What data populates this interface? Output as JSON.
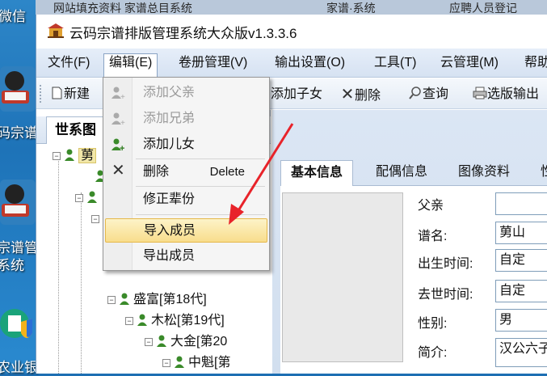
{
  "desktop": {
    "taskbar_items": [
      "网站填充资料 家谱总目系统",
      "家谱·系统",
      "应聘人员登记"
    ],
    "icons": [
      {
        "label": "微信",
        "icon": "wechat-icon"
      },
      {
        "label": "码宗谱",
        "icon": "genealogy-app-icon"
      },
      {
        "label": "宗谱管\n系统",
        "icon": "genealogy-system-icon"
      },
      {
        "label": "农业银",
        "icon": "bank-shield-icon"
      }
    ]
  },
  "window": {
    "title": "云码宗谱排版管理系统大众版v1.3.3.6",
    "icon": "temple-app-icon"
  },
  "menubar": {
    "items": [
      "文件(F)",
      "编辑(E)",
      "卷册管理(V)",
      "输出设置(O)",
      "工具(T)",
      "云管理(M)",
      "帮助"
    ],
    "active_index": 1
  },
  "toolbar": {
    "items": [
      {
        "label": "新建",
        "icon": "new-document-icon"
      },
      {
        "label": "添加子女",
        "icon": "add-child-icon"
      },
      {
        "label": "删除",
        "icon": "delete-x-icon"
      },
      {
        "label": "查询",
        "icon": "search-icon"
      },
      {
        "label": "选版输出",
        "icon": "printer-icon"
      }
    ]
  },
  "tree": {
    "tab_label": "世系图",
    "nodes": [
      {
        "label": "莮",
        "indent": 0,
        "selected": true
      },
      {
        "label": "",
        "indent": 1
      },
      {
        "label": "",
        "indent": 1
      },
      {
        "label": "",
        "indent": 2
      },
      {
        "label": "盛富[第18代]",
        "indent": 2
      },
      {
        "label": "木松[第19代]",
        "indent": 3
      },
      {
        "label": "大金[第20",
        "indent": 4
      },
      {
        "label": "中魁[第",
        "indent": 5
      }
    ]
  },
  "edit_menu": {
    "items": [
      {
        "label": "添加父亲",
        "disabled": true,
        "icon": "add-father-icon"
      },
      {
        "label": "添加兄弟",
        "disabled": true,
        "icon": "add-brother-icon"
      },
      {
        "label": "添加儿女",
        "disabled": false,
        "icon": "add-child-icon"
      },
      {
        "label": "删除",
        "disabled": false,
        "icon": "delete-x-icon",
        "shortcut": "Delete"
      },
      {
        "label": "修正辈份",
        "disabled": false
      },
      {
        "label": "导入成员",
        "disabled": false,
        "hover": true
      },
      {
        "label": "导出成员",
        "disabled": false
      }
    ]
  },
  "detail": {
    "tabs": [
      "基本信息",
      "配偶信息",
      "图像资料",
      "性"
    ],
    "active_tab": 0,
    "fields": [
      {
        "label": "父亲",
        "value": ""
      },
      {
        "label": "谱名:",
        "value": "莮山"
      },
      {
        "label": "出生时间:",
        "value": "自定"
      },
      {
        "label": "去世时间:",
        "value": "自定"
      },
      {
        "label": "性别:",
        "value": "男"
      },
      {
        "label": "简介:",
        "value": "汉公六子"
      }
    ]
  },
  "colors": {
    "menu_hover": "#f8dd8c",
    "arrow": "#e8232a",
    "selected_node": "#f2e7a8"
  }
}
